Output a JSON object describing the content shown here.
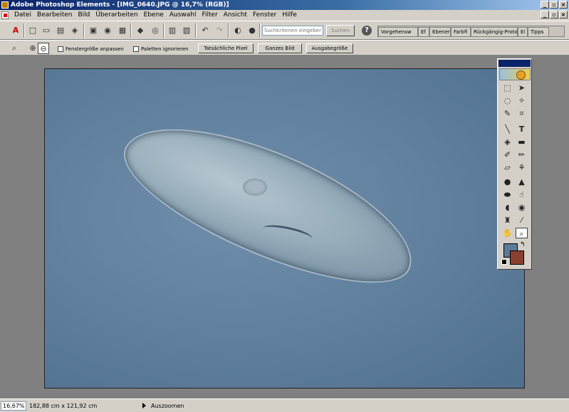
{
  "window": {
    "title": "Adobe Photoshop Elements - [IMG_0640.JPG @ 16,7% (RGB)]",
    "controls": [
      "_",
      "▫",
      "×"
    ]
  },
  "menubar": {
    "items": [
      "Datei",
      "Bearbeiten",
      "Bild",
      "Überarbeiten",
      "Ebene",
      "Auswahl",
      "Filter",
      "Ansicht",
      "Fenster",
      "Hilfe"
    ],
    "doc_controls": [
      "_",
      "▫",
      "×"
    ]
  },
  "toolbar": {
    "search_placeholder": "Suchkriterien eingeben",
    "search_button": "Suchen",
    "help_label": "?",
    "palette_tabs": [
      "Vorgehensw",
      "Ef",
      "Ebenen",
      "Farbfi",
      "Rückgängig-Protok",
      "Ei",
      "Tipps"
    ]
  },
  "options": {
    "checkbox_fit_window": "Fenstergröße anpassen",
    "checkbox_ignore_palettes": "Paletten ignorieren",
    "btn_actual_pixels": "Tatsächliche Pixel",
    "btn_fit_screen": "Ganzes Bild",
    "btn_print_size": "Ausgabegröße"
  },
  "status": {
    "zoom": "16,67%",
    "doc_size": "182,88 cm x 121,92 cm",
    "message": "Auszoomen"
  },
  "colors": {
    "foreground": "#5d7a96",
    "background": "#8a4030",
    "title_bar": "#0a246a"
  }
}
